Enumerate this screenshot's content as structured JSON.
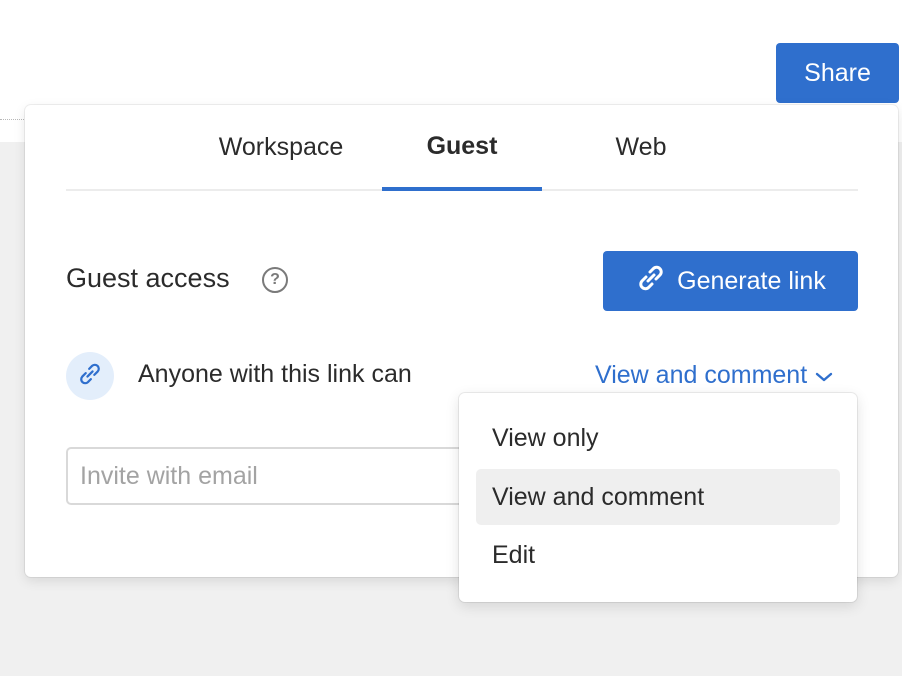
{
  "header": {
    "share_label": "Share"
  },
  "share_panel": {
    "tabs": [
      {
        "label": "Workspace",
        "active": false
      },
      {
        "label": "Guest",
        "active": true
      },
      {
        "label": "Web",
        "active": false
      }
    ],
    "guest": {
      "section_title": "Guest access",
      "generate_link_label": "Generate link",
      "link_permission_text": "Anyone with this link can",
      "selected_permission": "View and comment",
      "invite_placeholder": "Invite with email"
    }
  },
  "permission_menu": {
    "options": [
      {
        "label": "View only",
        "selected": false
      },
      {
        "label": "View and comment",
        "selected": true
      },
      {
        "label": "Edit",
        "selected": false
      }
    ]
  },
  "colors": {
    "accent": "#2f6fcd",
    "link_avatar_bg": "#e3eefb",
    "selected_item_bg": "#efefef"
  },
  "icons": [
    "help-icon",
    "link-icon",
    "chevron-down-icon"
  ]
}
